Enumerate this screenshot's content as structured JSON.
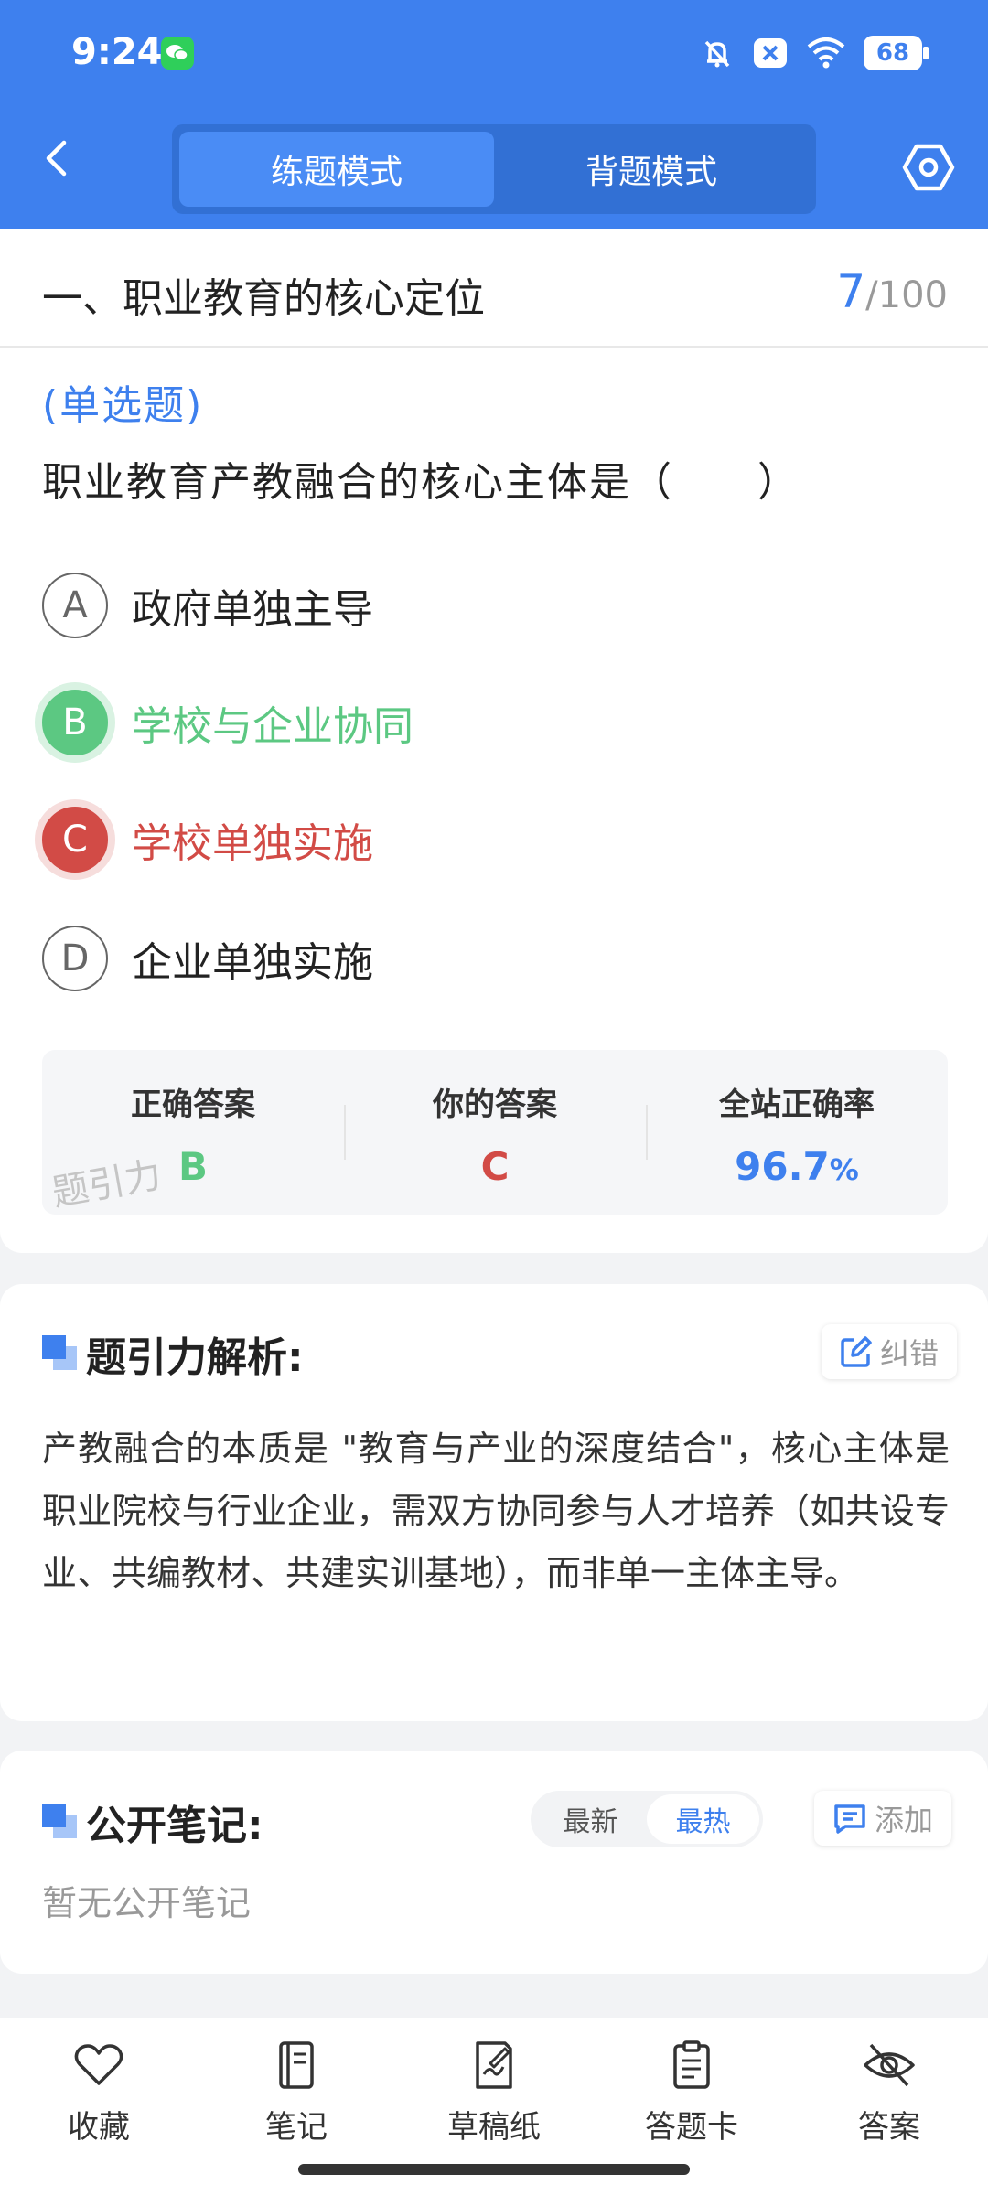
{
  "status_bar": {
    "time": "9:24",
    "battery": "68"
  },
  "header": {
    "tabs": [
      {
        "label": "练题模式",
        "active": true
      },
      {
        "label": "背题模式",
        "active": false
      }
    ]
  },
  "question_header": {
    "section_title": "一、职业教育的核心定位",
    "current": "7",
    "total": "/100"
  },
  "question": {
    "type_label": "(单选题)",
    "text": "职业教育产教融合的核心主体是（　　）"
  },
  "options": [
    {
      "letter": "A",
      "text": "政府单独主导",
      "state": "normal"
    },
    {
      "letter": "B",
      "text": "学校与企业协同",
      "state": "correct"
    },
    {
      "letter": "C",
      "text": "学校单独实施",
      "state": "wrong"
    },
    {
      "letter": "D",
      "text": "企业单独实施",
      "state": "normal"
    }
  ],
  "answer_summary": {
    "correct_label": "正确答案",
    "correct_value": "B",
    "yours_label": "你的答案",
    "yours_value": "C",
    "rate_label": "全站正确率",
    "rate_value": "96.7",
    "rate_unit": "%",
    "watermark": "题引力"
  },
  "analysis": {
    "title": "题引力解析:",
    "report_label": "纠错",
    "text": "产教融合的本质是 \"教育与产业的深度结合\"，核心主体是职业院校与行业企业，需双方协同参与人才培养（如共设专业、共编教材、共建实训基地），而非单一主体主导。"
  },
  "notes": {
    "title": "公开笔记:",
    "sort_options": [
      {
        "label": "最新",
        "active": false
      },
      {
        "label": "最热",
        "active": true
      }
    ],
    "add_label": "添加",
    "empty_text": "暂无公开笔记"
  },
  "bottom_nav": [
    {
      "label": "收藏",
      "icon": "heart-icon"
    },
    {
      "label": "笔记",
      "icon": "notebook-icon"
    },
    {
      "label": "草稿纸",
      "icon": "draft-paper-icon"
    },
    {
      "label": "答题卡",
      "icon": "answer-sheet-icon"
    },
    {
      "label": "答案",
      "icon": "eye-off-icon"
    }
  ],
  "colors": {
    "primary": "#3e80ee",
    "correct": "#5cc882",
    "wrong": "#d24b46"
  }
}
